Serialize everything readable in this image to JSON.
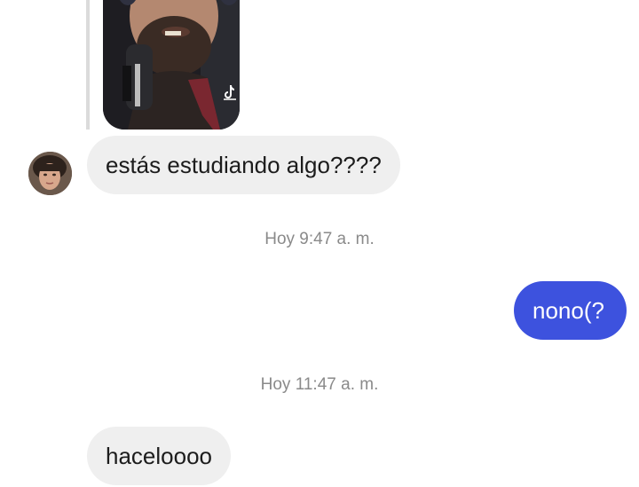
{
  "messages": {
    "m1": "estás estudiando algo????",
    "ts1": "Hoy 9:47 a. m.",
    "m2": "nono(?",
    "ts2": "Hoy 11:47 a. m.",
    "m3": "haceloooo"
  },
  "colors": {
    "incoming_bubble": "#efefef",
    "outgoing_bubble": "#3d52de",
    "timestamp": "#8a8a8a"
  },
  "icons": {
    "shared_video_badge": "tiktok-icon",
    "avatar": "contact-avatar"
  }
}
